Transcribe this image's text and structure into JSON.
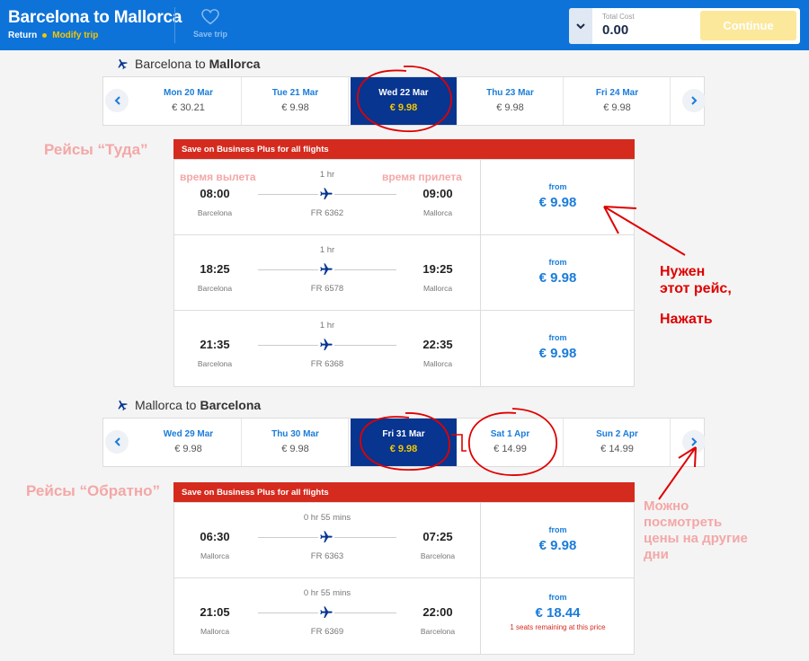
{
  "header": {
    "title": "Barcelona to Mallorca",
    "trip_type": "Return",
    "modify_label": "Modify trip",
    "save_trip_label": "Save trip",
    "total_cost_label": "Total Cost",
    "total_cost_value": "0.00",
    "continue_label": "Continue"
  },
  "outbound": {
    "from": "Barcelona",
    "to_word": "to",
    "to": "Mallorca",
    "dates": [
      {
        "date": "Mon 20 Mar",
        "price": "€ 30.21"
      },
      {
        "date": "Tue 21 Mar",
        "price": "€ 9.98"
      },
      {
        "date": "Wed 22 Mar",
        "price": "€ 9.98",
        "selected": true
      },
      {
        "date": "Thu 23 Mar",
        "price": "€ 9.98"
      },
      {
        "date": "Fri 24 Mar",
        "price": "€ 9.98"
      }
    ],
    "banner": "Save on Business Plus for all flights",
    "flights": [
      {
        "dep_time": "08:00",
        "dep_city": "Barcelona",
        "duration": "1 hr",
        "number": "FR 6362",
        "arr_time": "09:00",
        "arr_city": "Mallorca",
        "from_label": "from",
        "price": "€ 9.98"
      },
      {
        "dep_time": "18:25",
        "dep_city": "Barcelona",
        "duration": "1 hr",
        "number": "FR 6578",
        "arr_time": "19:25",
        "arr_city": "Mallorca",
        "from_label": "from",
        "price": "€ 9.98"
      },
      {
        "dep_time": "21:35",
        "dep_city": "Barcelona",
        "duration": "1 hr",
        "number": "FR 6368",
        "arr_time": "22:35",
        "arr_city": "Mallorca",
        "from_label": "from",
        "price": "€ 9.98"
      }
    ]
  },
  "return": {
    "from": "Mallorca",
    "to_word": "to",
    "to": "Barcelona",
    "dates": [
      {
        "date": "Wed 29 Mar",
        "price": "€ 9.98"
      },
      {
        "date": "Thu 30 Mar",
        "price": "€ 9.98"
      },
      {
        "date": "Fri 31 Mar",
        "price": "€ 9.98",
        "selected": true
      },
      {
        "date": "Sat 1 Apr",
        "price": "€ 14.99"
      },
      {
        "date": "Sun 2 Apr",
        "price": "€ 14.99"
      }
    ],
    "banner": "Save on Business Plus for all flights",
    "flights": [
      {
        "dep_time": "06:30",
        "dep_city": "Mallorca",
        "duration": "0 hr 55 mins",
        "number": "FR 6363",
        "arr_time": "07:25",
        "arr_city": "Barcelona",
        "from_label": "from",
        "price": "€ 9.98"
      },
      {
        "dep_time": "21:05",
        "dep_city": "Mallorca",
        "duration": "0 hr 55 mins",
        "number": "FR 6369",
        "arr_time": "22:00",
        "arr_city": "Barcelona",
        "from_label": "from",
        "price": "€ 18.44",
        "seats_note": "1 seats remaining at this price"
      }
    ]
  },
  "annotations": {
    "outbound_label": "Рейсы “Туда”",
    "return_label": "Рейсы “Обратно”",
    "dep_time_note": "время вылета",
    "arr_time_note": "время прилета",
    "need_flight_line1": "Нужен",
    "need_flight_line2": "этот рейс,",
    "press": "Нажать",
    "other_days_line1": "Можно",
    "other_days_line2": "посмотреть",
    "other_days_line3": "цены на другие",
    "other_days_line4": "дни"
  },
  "colors": {
    "header_blue": "#0d73d9",
    "selected_navy": "#073590",
    "accent_yellow": "#f3c600",
    "banner_red": "#d52b1e",
    "link_blue": "#1a7cd9",
    "annotation_red": "#e00000",
    "annotation_pink": "#f4a7a7"
  },
  "icons": [
    "plane-icon",
    "heart-icon",
    "chevron-down-icon",
    "chevron-left-icon",
    "chevron-right-icon"
  ]
}
